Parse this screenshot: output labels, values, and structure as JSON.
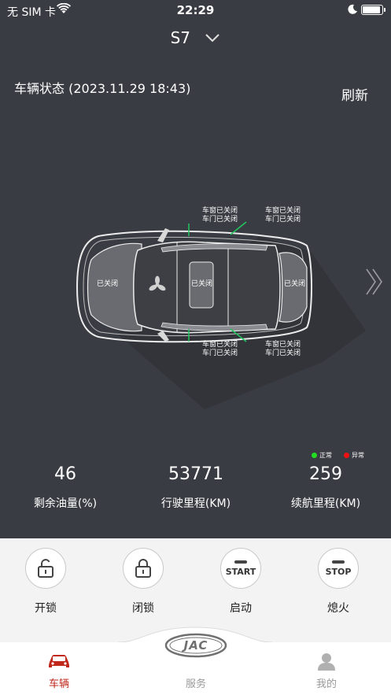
{
  "status_bar": {
    "carrier": "无 SIM 卡",
    "time": "22:29",
    "battery_level": 0.9
  },
  "header": {
    "model": "S7"
  },
  "vehicle_status": {
    "label": "车辆状态 (2023.11.29 18:43)",
    "refresh": "刷新"
  },
  "car_diagram": {
    "front_left": {
      "window": "车窗已关闭",
      "door": "车门已关闭"
    },
    "rear_left": {
      "window": "车窗已关闭",
      "door": "车门已关闭"
    },
    "front_right": {
      "window": "车窗已关闭",
      "door": "车门已关闭"
    },
    "rear_right": {
      "window": "车窗已关闭",
      "door": "车门已关闭"
    },
    "hood": "已关闭",
    "sunroof": "已关闭",
    "trunk": "已关闭"
  },
  "legend": {
    "normal": {
      "label": "正常",
      "color": "#22dd22"
    },
    "abnormal": {
      "label": "异常",
      "color": "#ee1111"
    }
  },
  "stats": [
    {
      "value": "46",
      "label": "剩余油量(%)"
    },
    {
      "value": "53771",
      "label": "行驶里程(KM)"
    },
    {
      "value": "259",
      "label": "续航里程(KM)"
    }
  ],
  "controls": {
    "unlock": {
      "label": "开锁"
    },
    "lock": {
      "label": "闭锁"
    },
    "start": {
      "label": "启动",
      "icon_text": "START"
    },
    "stop": {
      "label": "熄火",
      "icon_text": "STOP"
    }
  },
  "tabbar": {
    "vehicle": {
      "label": "车辆",
      "color": "#c0281c"
    },
    "service": {
      "label": "服务"
    },
    "mine": {
      "label": "我的"
    },
    "logo": "JAC"
  }
}
